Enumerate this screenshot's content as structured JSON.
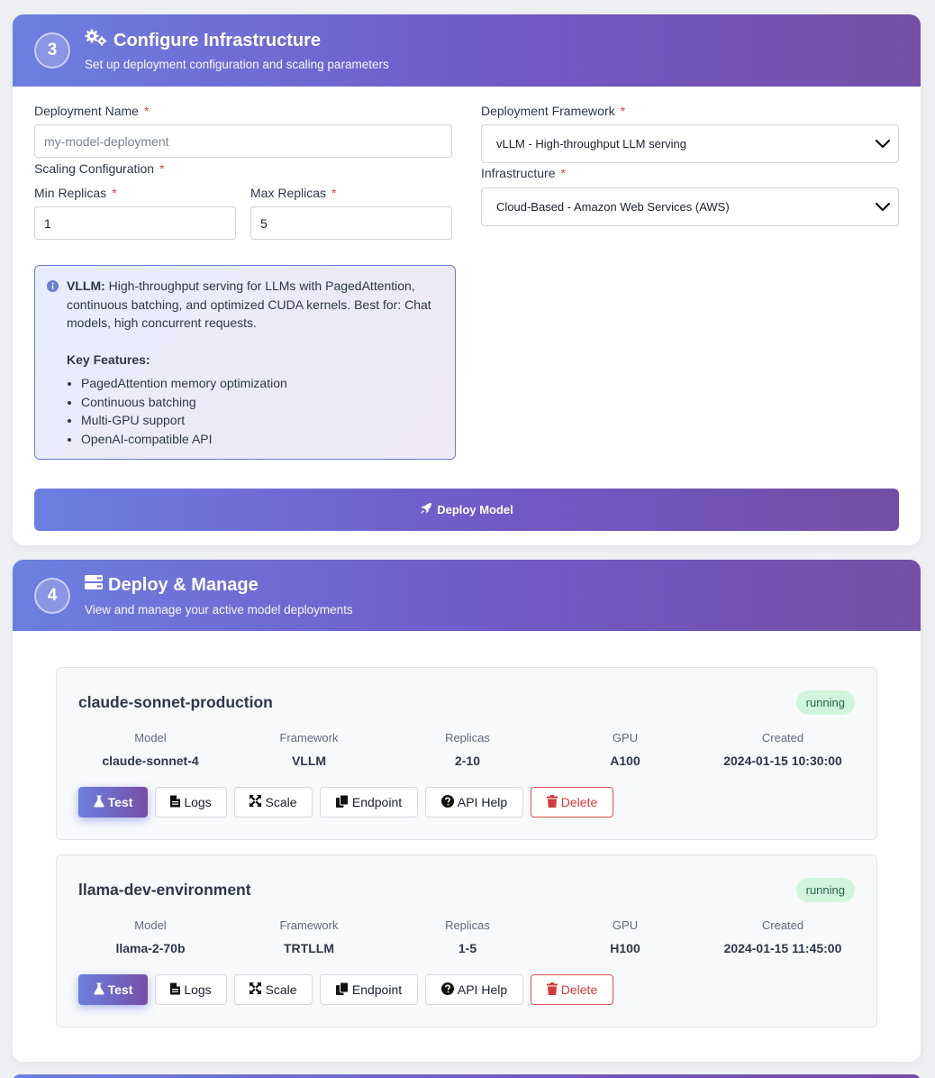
{
  "configure": {
    "step": "3",
    "title": "Configure Infrastructure",
    "subtitle": "Set up deployment configuration and scaling parameters",
    "deployment_name": {
      "label": "Deployment Name",
      "required": "*",
      "placeholder": "my-model-deployment",
      "value": ""
    },
    "scaling": {
      "label": "Scaling Configuration",
      "required": "*"
    },
    "min_replicas": {
      "label": "Min Replicas",
      "required": "*",
      "value": "1"
    },
    "max_replicas": {
      "label": "Max Replicas",
      "required": "*",
      "value": "5"
    },
    "framework": {
      "label": "Deployment Framework",
      "required": "*",
      "selected": "vLLM - High-throughput LLM serving"
    },
    "infrastructure": {
      "label": "Infrastructure",
      "required": "*",
      "selected": "Cloud-Based - Amazon Web Services (AWS)"
    },
    "info": {
      "name": "VLLM:",
      "description": "High-throughput serving for LLMs with PagedAttention, continuous batching, and optimized CUDA kernels. Best for: Chat models, high concurrent requests.",
      "features_title": "Key Features:",
      "features": [
        "PagedAttention memory optimization",
        "Continuous batching",
        "Multi-GPU support",
        "OpenAI-compatible API"
      ]
    },
    "deploy_button": "Deploy Model"
  },
  "manage": {
    "step": "4",
    "title": "Deploy & Manage",
    "subtitle": "View and manage your active model deployments",
    "columns": [
      "Model",
      "Framework",
      "Replicas",
      "GPU",
      "Created"
    ],
    "actions": {
      "test": "Test",
      "logs": "Logs",
      "scale": "Scale",
      "endpoint": "Endpoint",
      "api_help": "API Help",
      "delete": "Delete"
    },
    "deployments": [
      {
        "name": "claude-sonnet-production",
        "status": "running",
        "values": [
          "claude-sonnet-4",
          "VLLM",
          "2-10",
          "A100",
          "2024-01-15 10:30:00"
        ]
      },
      {
        "name": "llama-dev-environment",
        "status": "running",
        "values": [
          "llama-2-70b",
          "TRTLLM",
          "1-5",
          "H100",
          "2024-01-15 11:45:00"
        ]
      }
    ]
  },
  "colors": {
    "accent_start": "#6c7fe0",
    "accent_end": "#744fa6",
    "status_running_bg": "#d2f4dd",
    "delete_red": "#d33b3b"
  },
  "icons": {
    "configure": "cogs-icon",
    "manage": "server-icon",
    "info": "info-circle-icon",
    "deploy": "rocket-icon",
    "test": "flask-icon",
    "logs": "file-icon",
    "scale": "expand-arrows-icon",
    "endpoint": "copy-icon",
    "api_help": "question-circle-icon",
    "delete": "trash-icon",
    "select": "chevron-down-icon"
  }
}
